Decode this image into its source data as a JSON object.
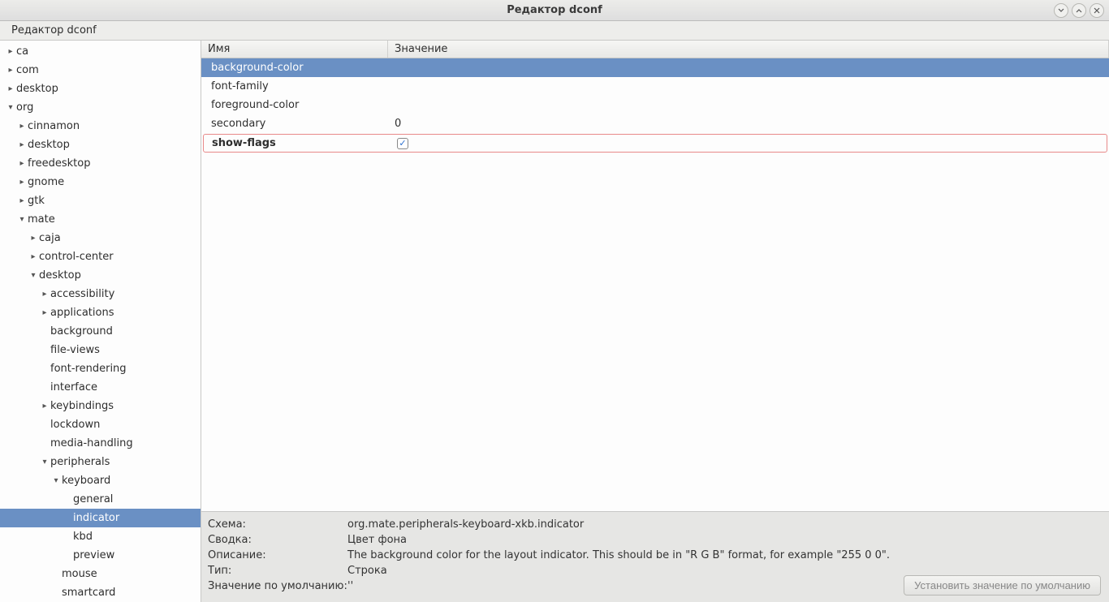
{
  "window": {
    "title": "Редактор dconf"
  },
  "menubar": {
    "items": [
      "Редактор dconf"
    ]
  },
  "tree": [
    {
      "label": "ca",
      "depth": 0,
      "arrow": "right"
    },
    {
      "label": "com",
      "depth": 0,
      "arrow": "right"
    },
    {
      "label": "desktop",
      "depth": 0,
      "arrow": "right"
    },
    {
      "label": "org",
      "depth": 0,
      "arrow": "down"
    },
    {
      "label": "cinnamon",
      "depth": 1,
      "arrow": "right"
    },
    {
      "label": "desktop",
      "depth": 1,
      "arrow": "right"
    },
    {
      "label": "freedesktop",
      "depth": 1,
      "arrow": "right"
    },
    {
      "label": "gnome",
      "depth": 1,
      "arrow": "right"
    },
    {
      "label": "gtk",
      "depth": 1,
      "arrow": "right"
    },
    {
      "label": "mate",
      "depth": 1,
      "arrow": "down"
    },
    {
      "label": "caja",
      "depth": 2,
      "arrow": "right"
    },
    {
      "label": "control-center",
      "depth": 2,
      "arrow": "right"
    },
    {
      "label": "desktop",
      "depth": 2,
      "arrow": "down"
    },
    {
      "label": "accessibility",
      "depth": 3,
      "arrow": "right"
    },
    {
      "label": "applications",
      "depth": 3,
      "arrow": "right"
    },
    {
      "label": "background",
      "depth": 3,
      "arrow": ""
    },
    {
      "label": "file-views",
      "depth": 3,
      "arrow": ""
    },
    {
      "label": "font-rendering",
      "depth": 3,
      "arrow": ""
    },
    {
      "label": "interface",
      "depth": 3,
      "arrow": ""
    },
    {
      "label": "keybindings",
      "depth": 3,
      "arrow": "right"
    },
    {
      "label": "lockdown",
      "depth": 3,
      "arrow": ""
    },
    {
      "label": "media-handling",
      "depth": 3,
      "arrow": ""
    },
    {
      "label": "peripherals",
      "depth": 3,
      "arrow": "down"
    },
    {
      "label": "keyboard",
      "depth": 4,
      "arrow": "down"
    },
    {
      "label": "general",
      "depth": 5,
      "arrow": ""
    },
    {
      "label": "indicator",
      "depth": 5,
      "arrow": "",
      "selected": true
    },
    {
      "label": "kbd",
      "depth": 5,
      "arrow": ""
    },
    {
      "label": "preview",
      "depth": 5,
      "arrow": ""
    },
    {
      "label": "mouse",
      "depth": 4,
      "arrow": ""
    },
    {
      "label": "smartcard",
      "depth": 4,
      "arrow": ""
    }
  ],
  "columns": {
    "name": "Имя",
    "value": "Значение"
  },
  "rows": [
    {
      "name": "background-color",
      "value": "",
      "selected": true,
      "highlighted": false,
      "checkbox": false
    },
    {
      "name": "font-family",
      "value": "",
      "selected": false,
      "highlighted": false,
      "checkbox": false
    },
    {
      "name": "foreground-color",
      "value": "",
      "selected": false,
      "highlighted": false,
      "checkbox": false
    },
    {
      "name": "secondary",
      "value": "0",
      "selected": false,
      "highlighted": false,
      "checkbox": false
    },
    {
      "name": "show-flags",
      "value": "",
      "selected": false,
      "highlighted": true,
      "checkbox": true,
      "checked": true
    }
  ],
  "details": {
    "schema_label": "Схема:",
    "schema_value": "org.mate.peripherals-keyboard-xkb.indicator",
    "summary_label": "Сводка:",
    "summary_value": "Цвет фона",
    "desc_label": "Описание:",
    "desc_value": "The background color for the layout indicator. This should be in \"R G B\" format, for example \"255 0 0\".",
    "type_label": "Тип:",
    "type_value": "Строка",
    "default_label": "Значение по умолчанию:",
    "default_value": "''",
    "button": "Установить значение по умолчанию"
  }
}
